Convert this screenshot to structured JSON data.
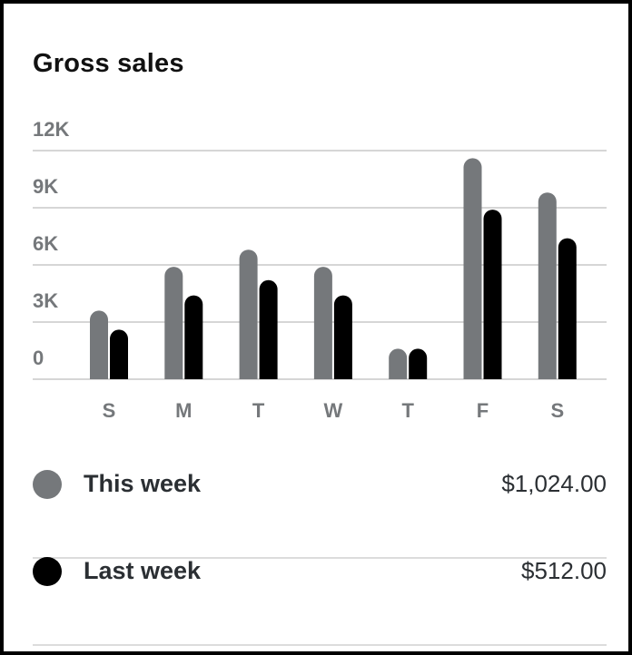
{
  "chart_data": {
    "type": "bar",
    "title": "Gross sales",
    "categories": [
      "S",
      "M",
      "T",
      "W",
      "T",
      "F",
      "S"
    ],
    "series": [
      {
        "name": "This week",
        "color": "#75787b",
        "values": [
          3600,
          5900,
          6800,
          5900,
          1600,
          11600,
          9800
        ]
      },
      {
        "name": "Last week",
        "color": "#000000",
        "values": [
          2600,
          4400,
          5200,
          4400,
          1600,
          8900,
          7400
        ]
      }
    ],
    "y_ticks": [
      {
        "value": 0,
        "label": "0"
      },
      {
        "value": 3000,
        "label": "3K"
      },
      {
        "value": 6000,
        "label": "6K"
      },
      {
        "value": 9000,
        "label": "9K"
      },
      {
        "value": 12000,
        "label": "12K"
      }
    ],
    "ylim": [
      0,
      12000
    ],
    "grid": true
  },
  "legend": [
    {
      "label": "This week",
      "amount": "$1,024.00",
      "color": "#75787b"
    },
    {
      "label": "Last week",
      "amount": "$512.00",
      "color": "#000000"
    }
  ]
}
